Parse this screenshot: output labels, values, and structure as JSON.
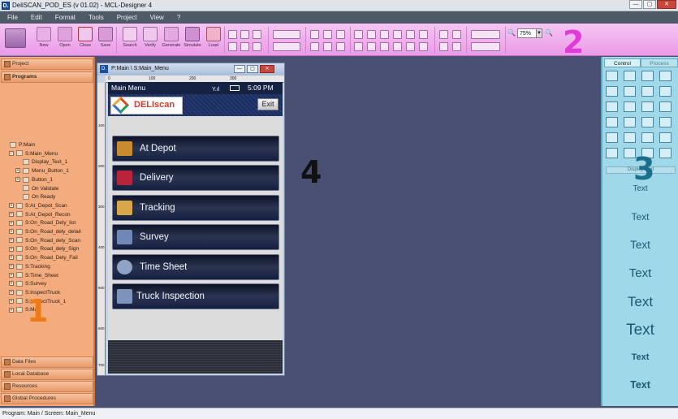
{
  "window": {
    "title": "DeliSCAN_POD_ES (v 01.02)  -  MCL-Designer 4",
    "app_icon": "D.",
    "controls": [
      "—",
      "▢",
      "✕"
    ]
  },
  "menu": [
    "File",
    "Edit",
    "Format",
    "Tools",
    "Project",
    "View",
    "?"
  ],
  "toolbar": {
    "labels": [
      "New",
      "Open",
      "Close",
      "Save",
      "Search",
      "Verify",
      "Generate",
      "Simulate",
      "Load"
    ],
    "zoom": "75%",
    "zoom_arrow": "▼"
  },
  "callouts": [
    "1",
    "2",
    "3",
    "4"
  ],
  "left_panel": {
    "sections_top": [
      "Project",
      "Programs"
    ],
    "tree": [
      {
        "label": "P:Main",
        "level": 0,
        "expander": ""
      },
      {
        "label": "S:Main_Menu",
        "level": 1,
        "expander": "−"
      },
      {
        "label": "Display_Text_1",
        "level": 2,
        "expander": ""
      },
      {
        "label": "Menu_Button_1",
        "level": 2,
        "expander": "+"
      },
      {
        "label": "Button_1",
        "level": 2,
        "expander": "+"
      },
      {
        "label": "On Validate",
        "level": 2,
        "expander": ""
      },
      {
        "label": "On Ready",
        "level": 2,
        "expander": ""
      },
      {
        "label": "S:At_Depot_Scan",
        "level": 1,
        "expander": "+"
      },
      {
        "label": "S:At_Depot_Recon",
        "level": 1,
        "expander": "+"
      },
      {
        "label": "S:On_Road_Dely_list",
        "level": 1,
        "expander": "+"
      },
      {
        "label": "S:On_Road_dely_detail",
        "level": 1,
        "expander": "+"
      },
      {
        "label": "S:On_Road_dely_Scan",
        "level": 1,
        "expander": "+"
      },
      {
        "label": "S:On_Road_dely_Sign",
        "level": 1,
        "expander": "+"
      },
      {
        "label": "S:On_Road_Dely_Fail",
        "level": 1,
        "expander": "+"
      },
      {
        "label": "S:Tracking",
        "level": 1,
        "expander": "+"
      },
      {
        "label": "S:Time_Sheet",
        "level": 1,
        "expander": "+"
      },
      {
        "label": "S:Survey",
        "level": 1,
        "expander": "+"
      },
      {
        "label": "S:InspectTruck",
        "level": 1,
        "expander": "+"
      },
      {
        "label": "S:InspectTruck_1",
        "level": 1,
        "expander": "+"
      },
      {
        "label": "S:Map",
        "level": 1,
        "expander": "+"
      }
    ],
    "sections_bottom": [
      "Data Files",
      "Local Database",
      "Resources",
      "Global Procedures"
    ]
  },
  "device_window": {
    "title": "P:Main \\ S:Main_Menu",
    "icon": "D.",
    "controls": [
      "—",
      "▢",
      "✕"
    ],
    "ruler_h": [
      "0",
      "100",
      "200",
      "300"
    ],
    "ruler_v": [
      "100",
      "200",
      "300",
      "400",
      "500",
      "600",
      "700"
    ]
  },
  "phone": {
    "header_title": "Main Menu",
    "signal": "Y.ıl",
    "time": "5:09 PM",
    "logo_text": "DELIscan",
    "exit_label": "Exit",
    "buttons": [
      {
        "label": "At Depot",
        "icon": "box-icon",
        "color": "#c98b2c"
      },
      {
        "label": "Delivery",
        "icon": "truck-icon",
        "color": "#b8253a"
      },
      {
        "label": "Tracking",
        "icon": "map-search-icon",
        "color": "#d9a64a"
      },
      {
        "label": "Survey",
        "icon": "grid-icon",
        "color": "#6f88b5"
      },
      {
        "label": "Time Sheet",
        "icon": "stopwatch-icon",
        "color": "#8fa3c6"
      },
      {
        "label": "Truck Inspection",
        "icon": "inspection-truck-icon",
        "color": "#7e93bb"
      }
    ]
  },
  "right_panel": {
    "tabs": [
      "Control",
      "Process"
    ],
    "section_label": "Display Text",
    "samples": [
      "Text",
      "Text",
      "Text",
      "Text",
      "Text",
      "Text",
      "Text",
      "Text"
    ]
  },
  "status": "Program: Main / Screen: Main_Menu",
  "colors": {
    "left_panel": "#f4ac7e",
    "toolbar": "#ec9ae8",
    "right_panel": "#9fd8e8",
    "callout_left": "#f07a16",
    "callout_top": "#e03bd6",
    "callout_right": "#1c6f8c",
    "callout_canvas": "#111111"
  }
}
